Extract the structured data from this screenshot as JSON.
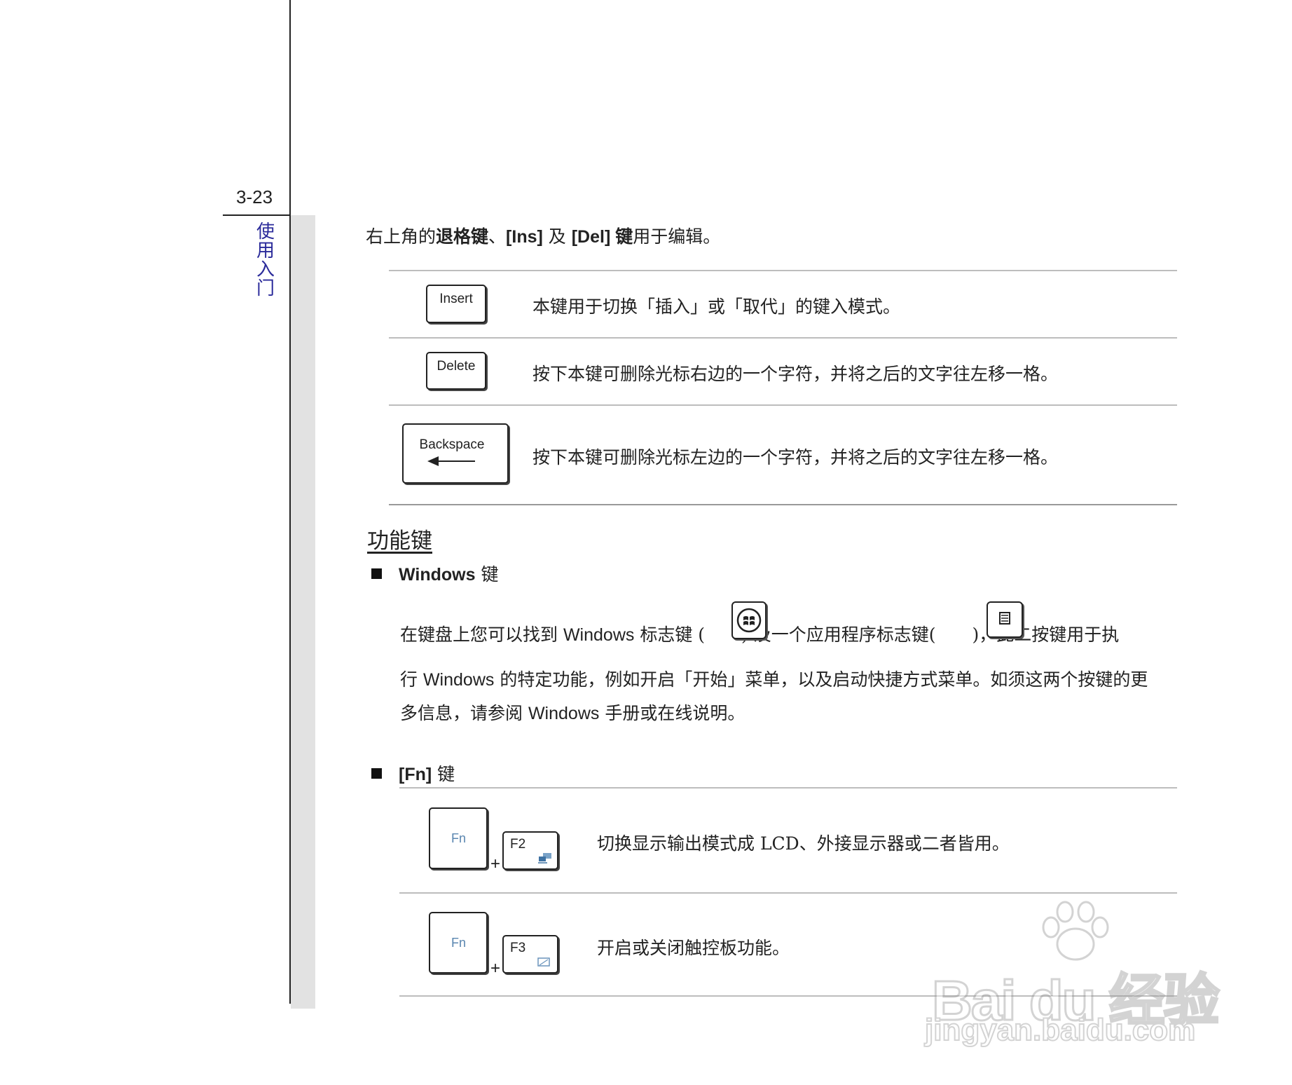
{
  "margin": {
    "page_number": "3-23",
    "section_title_chars": [
      "使",
      "用",
      "入",
      "门"
    ]
  },
  "intro": {
    "prefix": "右上角的",
    "bold1": "退格键",
    "sep": "、",
    "bold2": "[Ins]",
    "mid": " 及 ",
    "bold3": "[Del]",
    "bold4": " 键",
    "suffix": "用于编辑。"
  },
  "edit_keys": [
    {
      "key_label": "Insert",
      "description": "本键用于切换「插入」或「取代」的键入模式。"
    },
    {
      "key_label": "Delete",
      "description": "按下本键可删除光标右边的一个字符，并将之后的文字往左移一格。"
    },
    {
      "key_label": "Backspace",
      "description": "按下本键可删除光标左边的一个字符，并将之后的文字往左移一格。"
    }
  ],
  "function_keys": {
    "heading": "功能键",
    "windows": {
      "title_en": "Windows",
      "title_cn": " 键",
      "line1_a": "在键盘上您可以找到 ",
      "line1_b": "Windows",
      "line1_c": " 标志键 (",
      "line1_d": ")   及一个应用程序标志键(",
      "line1_e": ")，此二按键用于执",
      "line2_a": "行 ",
      "line2_b": "Windows",
      "line2_c": " 的特定功能，例如开启「开始」菜单，以及启动快捷方式菜单。如须这两个按键的更",
      "line3_a": "多信息，请参阅 ",
      "line3_b": "Windows",
      "line3_c": " 手册或在线说明。"
    },
    "fn": {
      "title_en": "[Fn]",
      "title_cn": " 键",
      "combos": [
        {
          "fn_label": "Fn",
          "plus": "+",
          "fkey_label": "F2",
          "icon": "display-switch-icon",
          "description": "切换显示输出模式成 LCD、外接显示器或二者皆用。"
        },
        {
          "fn_label": "Fn",
          "plus": "+",
          "fkey_label": "F3",
          "icon": "touchpad-icon",
          "description": "开启或关闭触控板功能。"
        }
      ]
    }
  },
  "watermark": {
    "brand": "Bai du 经验",
    "url": "jingyan.baidu.com"
  }
}
